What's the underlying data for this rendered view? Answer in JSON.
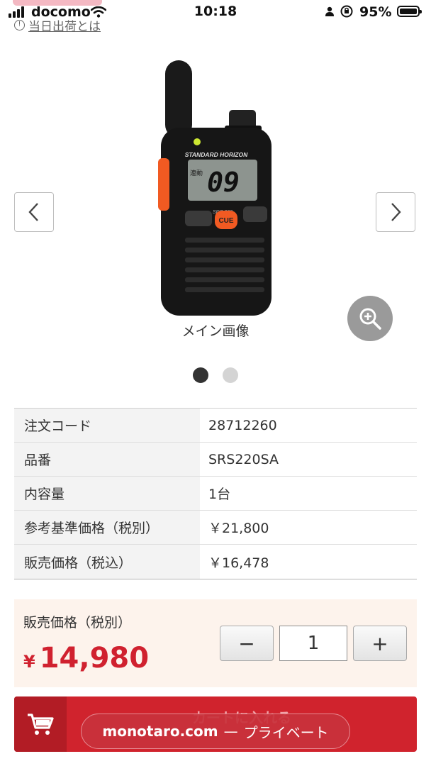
{
  "status_bar": {
    "carrier": "docomo",
    "time": "10:18",
    "battery_percent": "95%",
    "battery_level": 0.95
  },
  "shipping_info": {
    "link_text": "当日出荷とは"
  },
  "gallery": {
    "caption": "メイン画像",
    "image_count": 2,
    "active_index": 0,
    "product_label": "STANDARD HORIZON",
    "lcd_text": "09",
    "lcd_small": "連動",
    "model_label": "SRS 220",
    "cue_label": "CUE",
    "prev_icon": "chevron-left-icon",
    "next_icon": "chevron-right-icon",
    "zoom_icon": "zoom-in-icon"
  },
  "spec": [
    {
      "key": "注文コード",
      "value": "28712260"
    },
    {
      "key": "品番",
      "value": "SRS220SA"
    },
    {
      "key": "内容量",
      "value": "1台"
    },
    {
      "key": "参考基準価格（税別）",
      "value": "￥21,800"
    },
    {
      "key": "販売価格（税込）",
      "value": "￥16,478"
    }
  ],
  "price": {
    "label": "販売価格（税別）",
    "currency": "¥",
    "amount": "14,980"
  },
  "quantity": {
    "minus": "−",
    "value": "1",
    "plus": "+"
  },
  "cart": {
    "label": "カートに入れる",
    "icon": "cart-icon"
  },
  "url_bar": {
    "domain": "monotaro.com",
    "separator": "—",
    "mode": "プライベート"
  },
  "colors": {
    "accent": "#d0232d",
    "price": "#d0212f",
    "price_bg": "#fdf3ec"
  }
}
